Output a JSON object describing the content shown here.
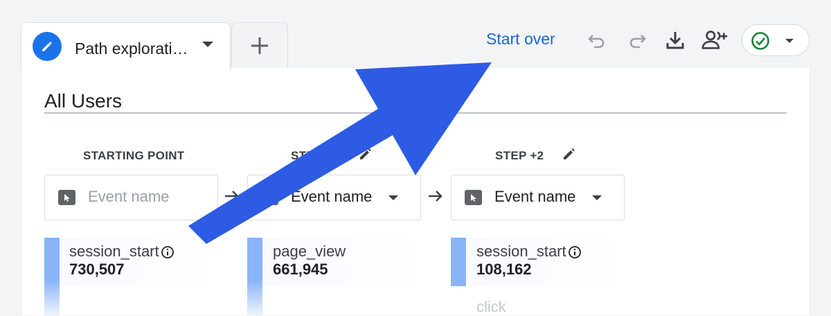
{
  "tabs": {
    "active_label": "Path explorati…",
    "active_icon": "pencil-icon",
    "add_icon": "plus-icon"
  },
  "toolbar": {
    "start_over_label": "Start over",
    "icons": [
      "undo-icon",
      "redo-icon",
      "download-icon",
      "share-users-icon",
      "check-circle-icon",
      "caret-down-icon"
    ],
    "status_color": "#188038"
  },
  "segment": {
    "title": "All Users"
  },
  "steps": [
    {
      "header": "STARTING POINT",
      "node_text": "Event name",
      "placeholder": true,
      "editable": false
    },
    {
      "header": "STEP +1",
      "node_text": "Event name",
      "placeholder": false,
      "editable": true
    },
    {
      "header": "STEP +2",
      "node_text": "Event name",
      "placeholder": false,
      "editable": true
    }
  ],
  "nodes": [
    {
      "event": "session_start",
      "count": "730,507",
      "info": true
    },
    {
      "event": "page_view",
      "count": "661,945",
      "info": false
    },
    {
      "event": "session_start",
      "count": "108,162",
      "info": true
    }
  ],
  "faded_node": "click",
  "colors": {
    "accent": "#1a73e8",
    "link": "#1967d2",
    "bar": "#8ab4f8",
    "annotation_arrow": "#2d5be3"
  }
}
